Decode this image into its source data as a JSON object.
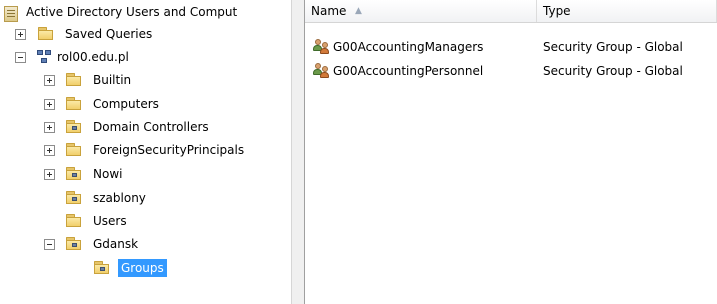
{
  "tree": {
    "root_label": "Active Directory Users and Comput",
    "saved_queries": "Saved Queries",
    "domain": "rol00.edu.pl",
    "builtin": "Builtin",
    "computers": "Computers",
    "domain_controllers": "Domain Controllers",
    "foreign_security_principals": "ForeignSecurityPrincipals",
    "nowi": "Nowi",
    "szablony": "szablony",
    "users": "Users",
    "gdansk": "Gdansk",
    "groups": "Groups"
  },
  "list": {
    "columns": {
      "name": "Name",
      "type": "Type"
    },
    "sort_indicator": "▲",
    "rows": [
      {
        "name": "G00AccountingManagers",
        "type": "Security Group - Global"
      },
      {
        "name": "G00AccountingPersonnel",
        "type": "Security Group - Global"
      }
    ]
  },
  "colors": {
    "selection": "#3399ff",
    "folder": "#f1cf6b"
  },
  "icons": {
    "root": "console-snapin-icon",
    "folder": "folder-icon",
    "ou": "organizational-unit-icon",
    "domain": "domain-icon",
    "group": "security-group-icon"
  }
}
